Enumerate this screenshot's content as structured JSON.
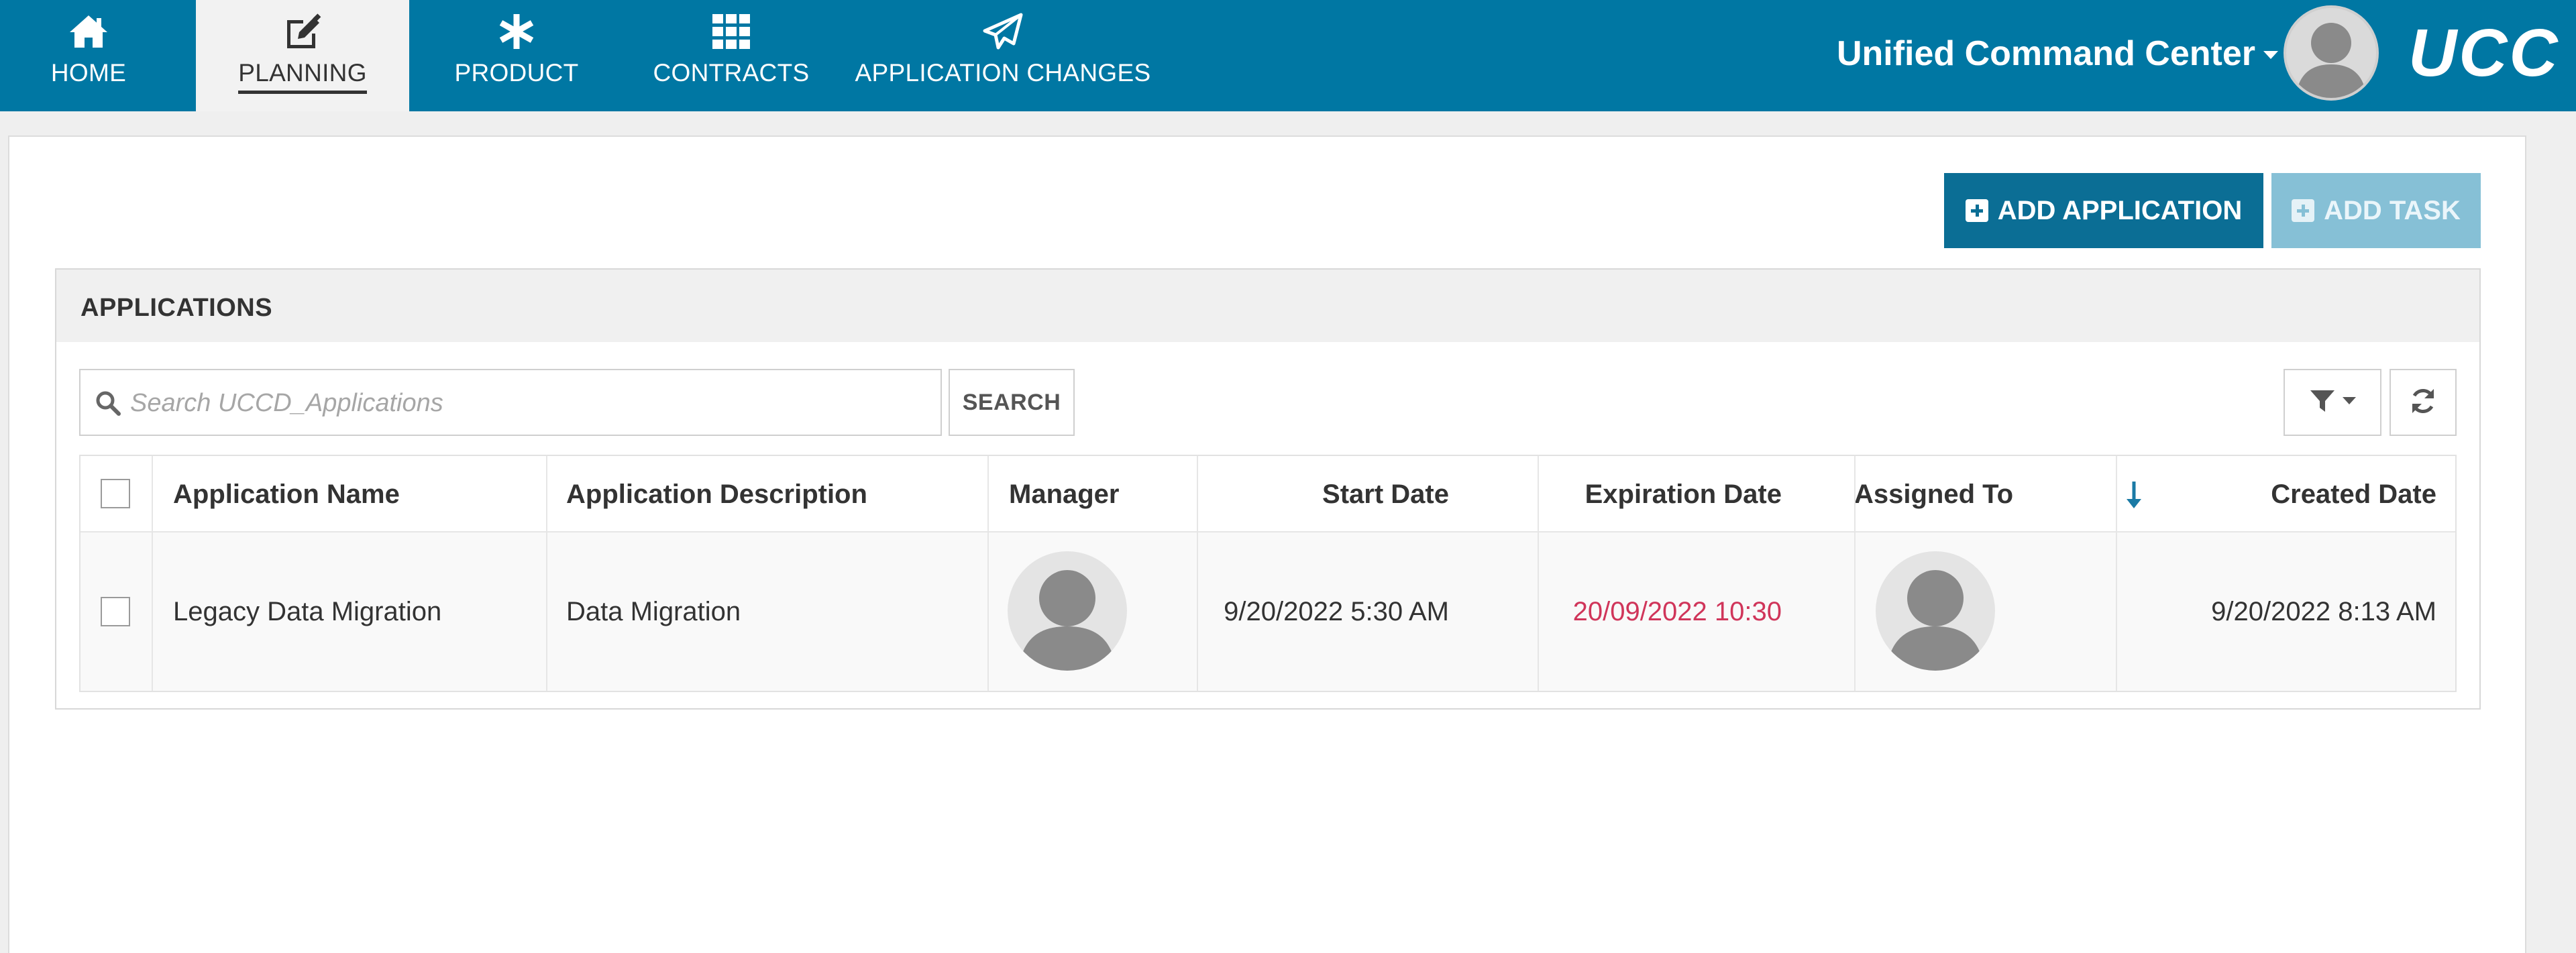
{
  "nav": {
    "items": [
      {
        "label": "HOME",
        "icon": "home-icon"
      },
      {
        "label": "PLANNING",
        "icon": "edit-icon",
        "active": true
      },
      {
        "label": "PRODUCT",
        "icon": "asterisk-icon"
      },
      {
        "label": "CONTRACTS",
        "icon": "grid-icon"
      },
      {
        "label": "APPLICATION CHANGES",
        "icon": "paper-plane-icon"
      }
    ],
    "brand_title": "Unified Command Center",
    "logo_text": "UCC",
    "user_avatar_icon": "user-avatar-icon"
  },
  "toolbar": {
    "add_application_label": "ADD APPLICATION",
    "add_task_label": "ADD TASK"
  },
  "panel": {
    "title": "APPLICATIONS",
    "search_placeholder": "Search UCCD_Applications",
    "search_value": "",
    "search_button": "SEARCH",
    "filter_icon": "filter-icon",
    "refresh_icon": "refresh-icon"
  },
  "table": {
    "columns": [
      "Application Name",
      "Application Description",
      "Manager",
      "Start Date",
      "Expiration Date",
      "Assigned To",
      "Created Date"
    ],
    "sorted_column": "Created Date",
    "sort_direction": "descending",
    "rows": [
      {
        "checked": false,
        "application_name": "Legacy Data Migration",
        "application_description": "Data Migration",
        "manager_avatar": "user-avatar-icon",
        "start_date": "9/20/2022 5:30 AM",
        "expiration_date": "20/09/2022 10:30",
        "assigned_to_avatar": "user-avatar-icon",
        "created_date": "9/20/2022 8:13 AM"
      }
    ]
  },
  "colors": {
    "brand": "#0077a3",
    "primary_button": "#0b6e95",
    "disabled_button": "#86c0d6",
    "expired_date": "#d0355a"
  }
}
